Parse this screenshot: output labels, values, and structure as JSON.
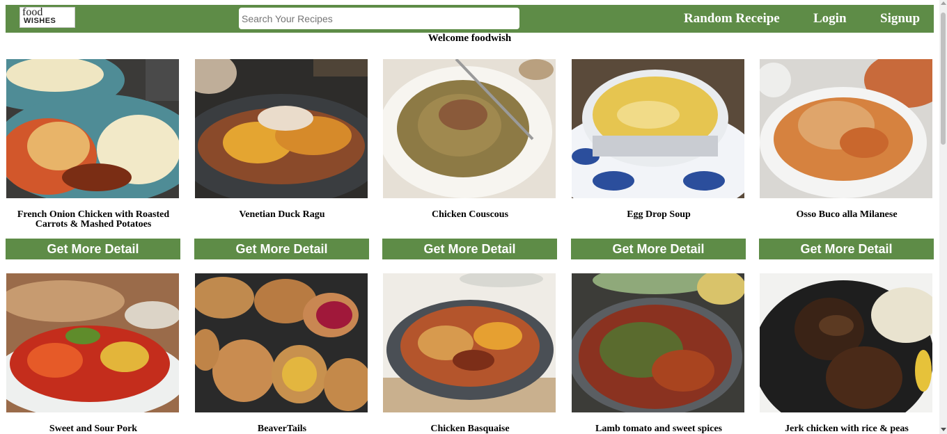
{
  "navbar": {
    "logo_line1": "food",
    "logo_line2": "WISHES",
    "search_placeholder": "Search Your Recipes",
    "random_recipe": "Random Receipe",
    "login": "Login",
    "signup": "Signup"
  },
  "welcome": "Welcome foodwish",
  "button_label": "Get More Detail",
  "recipes": [
    {
      "title": "French Onion Chicken with Roasted Carrots & Mashed Potatoes"
    },
    {
      "title": "Venetian Duck Ragu"
    },
    {
      "title": "Chicken Couscous"
    },
    {
      "title": "Egg Drop Soup"
    },
    {
      "title": "Osso Buco alla Milanese"
    },
    {
      "title": "Sweet and Sour Pork"
    },
    {
      "title": "BeaverTails"
    },
    {
      "title": "Chicken Basquaise"
    },
    {
      "title": "Lamb tomato and sweet spices"
    },
    {
      "title": "Jerk chicken with rice & peas"
    }
  ],
  "colors": {
    "accent": "#5e8c47"
  }
}
